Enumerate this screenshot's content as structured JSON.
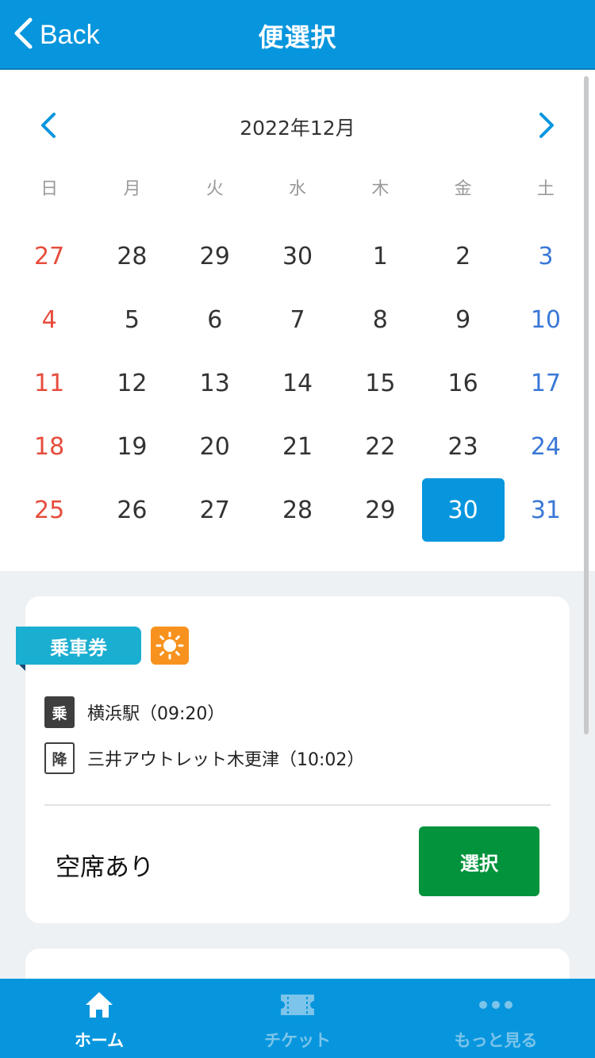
{
  "header": {
    "back_label": "Back",
    "title": "便選択"
  },
  "calendar": {
    "month_label": "2022年12月",
    "weekdays": [
      "日",
      "月",
      "火",
      "水",
      "木",
      "金",
      "土"
    ],
    "weeks": [
      [
        "27",
        "28",
        "29",
        "30",
        "1",
        "2",
        "3"
      ],
      [
        "4",
        "5",
        "6",
        "7",
        "8",
        "9",
        "10"
      ],
      [
        "11",
        "12",
        "13",
        "14",
        "15",
        "16",
        "17"
      ],
      [
        "18",
        "19",
        "20",
        "21",
        "22",
        "23",
        "24"
      ],
      [
        "25",
        "26",
        "27",
        "28",
        "29",
        "30",
        "31"
      ]
    ],
    "selected_day": "30",
    "colors": {
      "sunday": "#e74c3c",
      "saturday": "#3a78d6",
      "selected_bg": "#0796dd"
    }
  },
  "trip": {
    "ticket_type": "乗車券",
    "weather_icon": "sun-icon",
    "board_mark": "乗",
    "board_stop": "横浜駅（09:20）",
    "alight_mark": "降",
    "alight_stop": "三井アウトレット木更津（10:02）",
    "availability": "空席あり",
    "select_label": "選択"
  },
  "bottom_nav": {
    "items": [
      {
        "label": "ホーム",
        "icon": "home-icon",
        "active": true
      },
      {
        "label": "チケット",
        "icon": "ticket-icon",
        "active": false
      },
      {
        "label": "もっと見る",
        "icon": "more-icon",
        "active": false
      }
    ]
  },
  "colors": {
    "primary": "#0796dd",
    "select_button": "#02933c",
    "ribbon": "#1aaed0",
    "weather": "#f7921e"
  }
}
